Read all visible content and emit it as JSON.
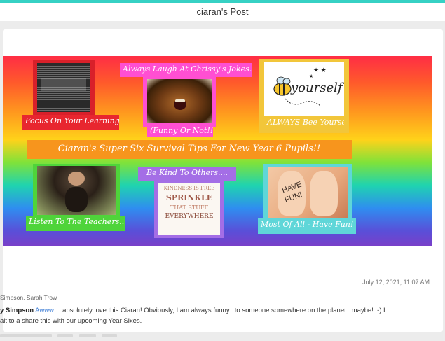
{
  "header": {
    "title": "ciaran's Post"
  },
  "poster": {
    "title": "Ciaran's Super Six Survival Tips For New Year 6 Pupils!!",
    "tips": [
      {
        "caption": "Focus On Your Learning!"
      },
      {
        "caption": "Always Laugh At Chrissy's Jokes....",
        "subcaption": "(Funny Or Not!!)"
      },
      {
        "caption": "ALWAYS Bee Yourself!",
        "image_text": "yourself"
      },
      {
        "caption": "Listen To The Teachers...."
      },
      {
        "caption": "Be Kind To Others....",
        "image_text": [
          "KINDNESS IS FREE",
          "SPRINKLE",
          "THAT STUFF",
          "EVERYWHERE"
        ]
      },
      {
        "caption": "Most Of All - Have Fun!",
        "image_text": [
          "HAVE",
          "FUN!"
        ]
      }
    ]
  },
  "post": {
    "timestamp": "July 12, 2021, 11:07 AM",
    "likers": "Simpson, Sarah Trow",
    "comment": {
      "author": "y Simpson",
      "link_text": "Awww...l",
      "text_line1": " absolutely love this Ciaran! Obviously, I am always funny...to someone somewhere on the planet...maybe! :-) I",
      "text_line2": "ait to a share this with our upcoming Year Sixes."
    }
  },
  "colors": {
    "accent_top": "#36d1c4",
    "caption_red": "#e8262f",
    "caption_pink": "#ff4fd2",
    "caption_yellow": "#f2c63a",
    "banner_orange": "#f7951d",
    "caption_green": "#4fd43a",
    "caption_purple": "#a46ee6",
    "caption_cyan": "#5fd6d8",
    "link_blue": "#3a7bd5"
  }
}
